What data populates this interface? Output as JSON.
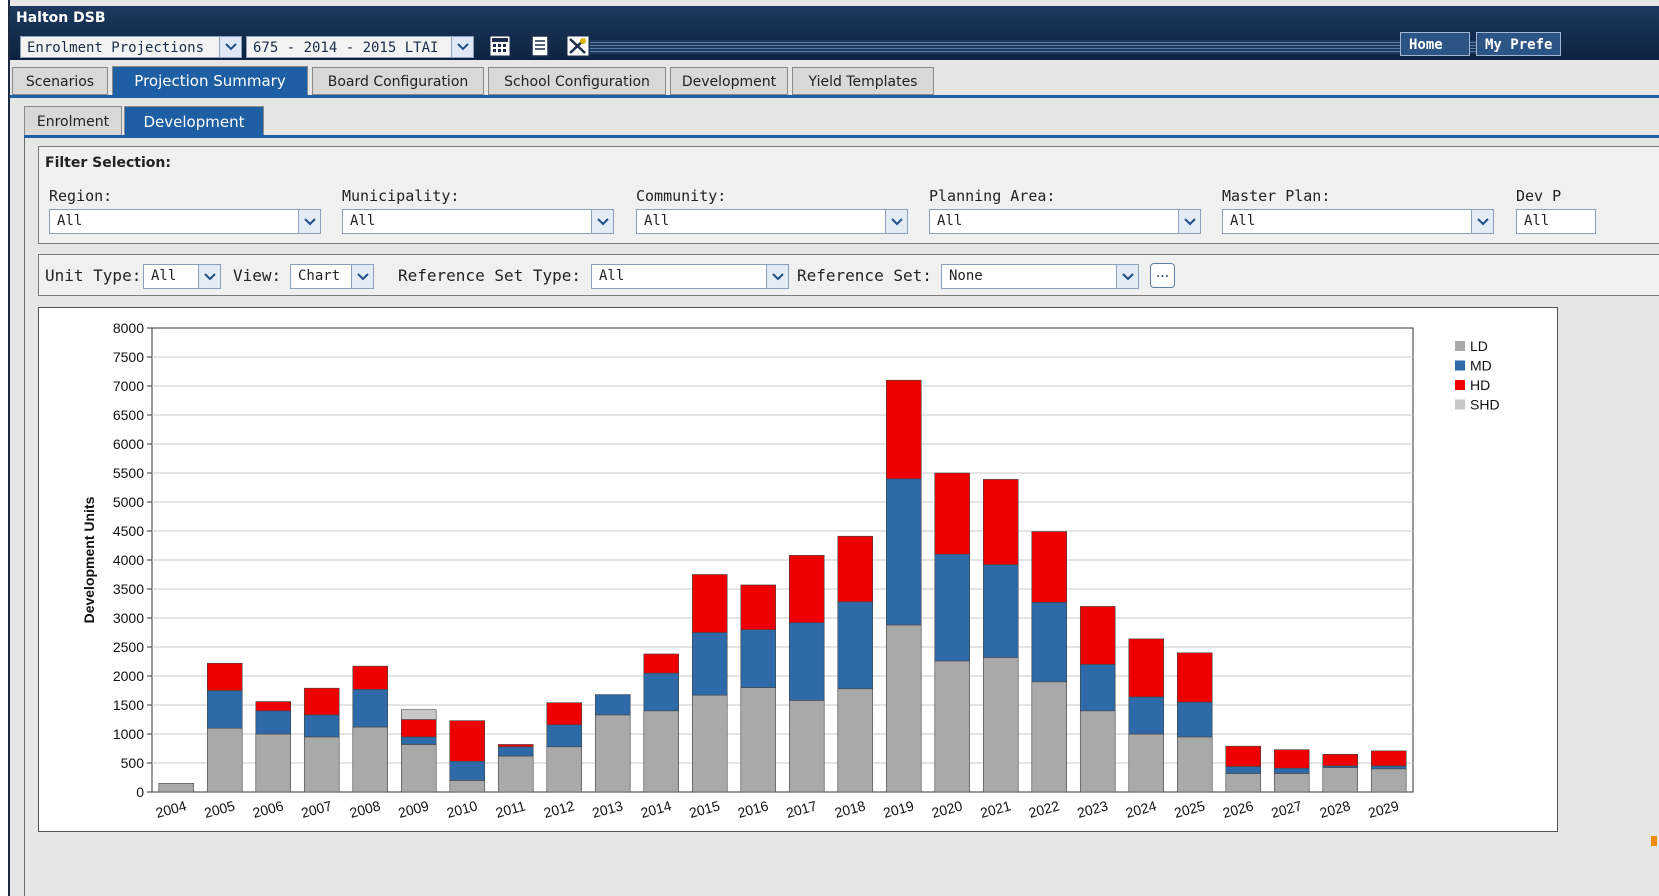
{
  "header": {
    "title": "Halton DSB",
    "module_select": "Enrolment Projections",
    "projection_select": "675 - 2014 - 2015 LTAI",
    "home_label": "Home",
    "prefs_label": "My Prefe"
  },
  "tabs": [
    {
      "label": "Scenarios"
    },
    {
      "label": "Projection Summary"
    },
    {
      "label": "Board Configuration"
    },
    {
      "label": "School Configuration"
    },
    {
      "label": "Development"
    },
    {
      "label": "Yield Templates"
    }
  ],
  "subtabs": [
    {
      "label": "Enrolment"
    },
    {
      "label": "Development"
    }
  ],
  "filters": {
    "title": "Filter Selection:",
    "items": [
      {
        "label": "Region:",
        "value": "All"
      },
      {
        "label": "Municipality:",
        "value": "All"
      },
      {
        "label": "Community:",
        "value": "All"
      },
      {
        "label": "Planning Area:",
        "value": "All"
      },
      {
        "label": "Master Plan:",
        "value": "All"
      },
      {
        "label": "Dev P",
        "value": "All"
      }
    ]
  },
  "options": {
    "unit_type_label": "Unit Type:",
    "unit_type_value": "All",
    "view_label": "View:",
    "view_value": "Chart",
    "ref_type_label": "Reference Set Type:",
    "ref_type_value": "All",
    "ref_set_label": "Reference Set:",
    "ref_set_value": "None",
    "more_label": "..."
  },
  "chart_data": {
    "type": "bar",
    "stacked": true,
    "ylabel": "Development Units",
    "ylim": [
      0,
      8000
    ],
    "ytick_step": 500,
    "grid": true,
    "legend": "top-right",
    "categories": [
      "2004",
      "2005",
      "2006",
      "2007",
      "2008",
      "2009",
      "2010",
      "2011",
      "2012",
      "2013",
      "2014",
      "2015",
      "2016",
      "2017",
      "2018",
      "2019",
      "2020",
      "2021",
      "2022",
      "2023",
      "2024",
      "2025",
      "2026",
      "2027",
      "2028",
      "2029"
    ],
    "series": [
      {
        "name": "LD",
        "color": "#a9a9a9",
        "values": [
          150,
          1100,
          1000,
          950,
          1120,
          820,
          200,
          620,
          780,
          1330,
          1400,
          1670,
          1800,
          1580,
          1780,
          2880,
          2260,
          2320,
          1900,
          1400,
          1000,
          950,
          320,
          320,
          420,
          400
        ]
      },
      {
        "name": "MD",
        "color": "#2e6aa8",
        "values": [
          0,
          650,
          400,
          380,
          650,
          130,
          330,
          160,
          380,
          350,
          650,
          1080,
          1000,
          1340,
          1500,
          2520,
          1840,
          1600,
          1370,
          800,
          640,
          600,
          120,
          90,
          30,
          50
        ]
      },
      {
        "name": "HD",
        "color": "#ee0000",
        "values": [
          0,
          470,
          160,
          460,
          400,
          300,
          700,
          40,
          380,
          0,
          330,
          1000,
          770,
          1160,
          1130,
          1700,
          1400,
          1470,
          1220,
          1000,
          1000,
          850,
          350,
          320,
          200,
          260
        ]
      },
      {
        "name": "SHD",
        "color": "#c8c8c8",
        "values": [
          0,
          0,
          0,
          0,
          0,
          170,
          0,
          0,
          0,
          0,
          0,
          0,
          0,
          0,
          0,
          0,
          0,
          0,
          0,
          0,
          0,
          0,
          0,
          0,
          0,
          0
        ]
      }
    ]
  }
}
